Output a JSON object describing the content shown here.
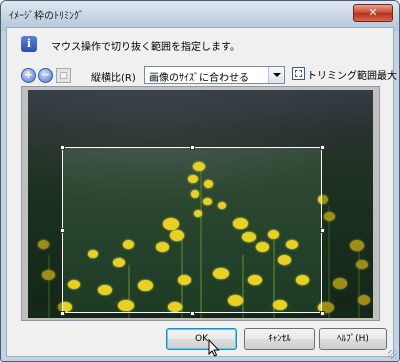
{
  "window": {
    "title": "ｲﾒｰｼﾞ枠のﾄﾘﾐﾝｸﾞ",
    "close_label": "✕"
  },
  "instruction": {
    "icon": "info-icon",
    "icon_glyph": "i",
    "text": "マウス操作で切り抜く範囲を指定します。"
  },
  "toolbar": {
    "zoom_in_glyph": "+",
    "zoom_out_glyph": "−",
    "aspect_label": "縦横比(R)",
    "aspect_value": "画像のｻｲｽﾞに合わせる",
    "max_trim_label": "トリミング範囲最大"
  },
  "buttons": {
    "ok": "OK",
    "cancel": "ｷｬﾝｾﾙ",
    "help": "ﾍﾙﾌﾟ(H)"
  },
  "colors": {
    "accent": "#3c7fb1",
    "flower": "#e8d21f",
    "foliage": "#28452c"
  }
}
